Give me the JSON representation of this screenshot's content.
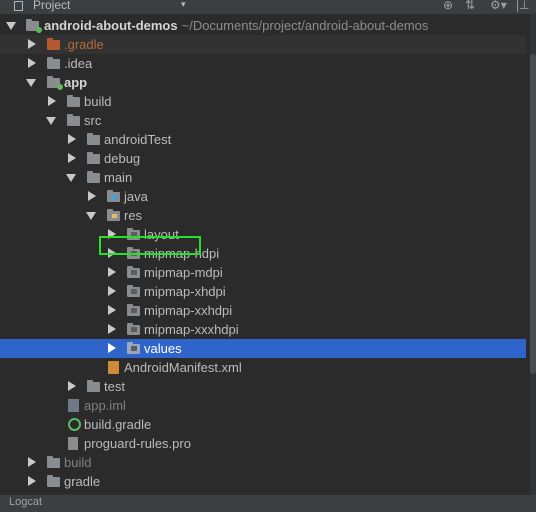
{
  "header": {
    "title": "Project",
    "caret": "▾"
  },
  "header_buttons": [
    "⊕",
    "⇅",
    "⚙▾",
    "|⊥"
  ],
  "tree": [
    {
      "label": "android-about-demos",
      "path": "~/Documents/project/android-about-demos",
      "icon": "module-folder-icon",
      "arrow": "down"
    },
    {
      "label": ".gradle",
      "icon": "folder-icon",
      "arrow": "right"
    },
    {
      "label": ".idea",
      "icon": "folder-icon",
      "arrow": "right"
    },
    {
      "label": "app",
      "icon": "module-folder-icon",
      "arrow": "down"
    },
    {
      "label": "build",
      "icon": "folder-icon",
      "arrow": "right"
    },
    {
      "label": "src",
      "icon": "folder-icon",
      "arrow": "down"
    },
    {
      "label": "androidTest",
      "icon": "folder-icon",
      "arrow": "right"
    },
    {
      "label": "debug",
      "icon": "folder-icon",
      "arrow": "right"
    },
    {
      "label": "main",
      "icon": "folder-icon",
      "arrow": "down"
    },
    {
      "label": "java",
      "icon": "source-folder-icon",
      "arrow": "right"
    },
    {
      "label": "res",
      "icon": "resource-folder-icon",
      "arrow": "down"
    },
    {
      "label": "layout",
      "icon": "folder-icon",
      "arrow": "right"
    },
    {
      "label": "mipmap-hdpi",
      "icon": "folder-icon",
      "arrow": "right"
    },
    {
      "label": "mipmap-mdpi",
      "icon": "folder-icon",
      "arrow": "right"
    },
    {
      "label": "mipmap-xhdpi",
      "icon": "folder-icon",
      "arrow": "right"
    },
    {
      "label": "mipmap-xxhdpi",
      "icon": "folder-icon",
      "arrow": "right"
    },
    {
      "label": "mipmap-xxxhdpi",
      "icon": "folder-icon",
      "arrow": "right"
    },
    {
      "label": "values",
      "icon": "folder-icon",
      "arrow": "right",
      "selected": true
    },
    {
      "label": "AndroidManifest.xml",
      "icon": "xml-file-icon"
    },
    {
      "label": "test",
      "icon": "folder-icon",
      "arrow": "right"
    },
    {
      "label": "app.iml",
      "icon": "iml-file-icon"
    },
    {
      "label": "build.gradle",
      "icon": "gradle-file-icon"
    },
    {
      "label": "proguard-rules.pro",
      "icon": "text-file-icon"
    },
    {
      "label": "build",
      "icon": "folder-icon",
      "arrow": "right"
    },
    {
      "label": "gradle",
      "icon": "folder-icon",
      "arrow": "right"
    }
  ],
  "footer": {
    "label": "Logcat"
  },
  "colors": {
    "selection": "#2f65ca",
    "highlight_box": "#28e028",
    "background": "#2b2b2b"
  }
}
